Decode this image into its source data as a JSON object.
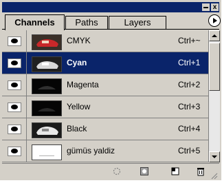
{
  "window": {
    "minimize_icon": "minimize-icon",
    "close_label": "x"
  },
  "tabs": [
    {
      "label": "Channels",
      "active": true
    },
    {
      "label": "Paths",
      "active": false
    },
    {
      "label": "Layers",
      "active": false
    }
  ],
  "channels": [
    {
      "name": "CMYK",
      "shortcut": "Ctrl+~",
      "visible": true,
      "selected": false
    },
    {
      "name": "Cyan",
      "shortcut": "Ctrl+1",
      "visible": true,
      "selected": true
    },
    {
      "name": "Magenta",
      "shortcut": "Ctrl+2",
      "visible": true,
      "selected": false
    },
    {
      "name": "Yellow",
      "shortcut": "Ctrl+3",
      "visible": true,
      "selected": false
    },
    {
      "name": "Black",
      "shortcut": "Ctrl+4",
      "visible": true,
      "selected": false
    },
    {
      "name": "gümüs yaldiz",
      "shortcut": "Ctrl+5",
      "visible": true,
      "selected": false
    }
  ],
  "bottom_icons": [
    "load-selection-icon",
    "save-selection-icon",
    "new-channel-icon",
    "delete-channel-icon"
  ],
  "colors": {
    "selection": "#0a246a",
    "panel": "#d4d0c8"
  }
}
